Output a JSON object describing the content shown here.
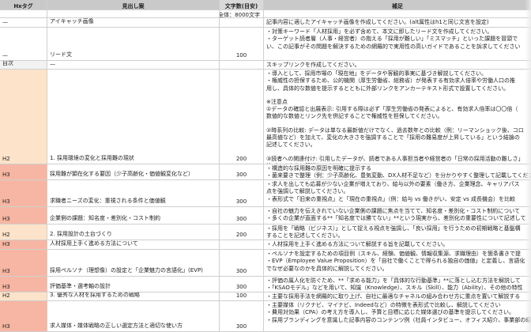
{
  "header": {
    "col1": "Hxタグ",
    "col2": "見出し案",
    "col3": "文字数(目安)",
    "col4": "補足"
  },
  "total_row": {
    "label": "全体：8000文字"
  },
  "rows": [
    {
      "tag": "—",
      "heading": "アイキャッチ画像",
      "chars": "",
      "notes": [
        "記事内容に適したアイキャッチ画像を作成してください。(alt属性はh1と同じ文言を設定)"
      ]
    },
    {
      "tag": "—",
      "heading": "リード文",
      "chars": "100",
      "notes": [
        "・対策キーワード「人材採用」を必ず含めて、本文に即したリード文を作成してください。",
        "・ターゲット読者層（人事・経営者）の抱える「採用が難しい」「ミスマッチ」といった課題を冒頭で",
        "い、この記事がその問題を解決するための網羅的で実用性の高いガイドであることを訴求してください"
      ]
    },
    {
      "tag": "目次",
      "heading": "—",
      "chars": "",
      "notes": [
        "スキップリンクを作成してください。"
      ]
    },
    {
      "tag": "H2",
      "heading": "1.  採用環境の変化と採用難の現状",
      "chars": "200",
      "notes": [
        "・導入として、採用市場の「現在地」をデータや客観的事実に基づき解説してください。",
        "・権威性の担保するため、公的機関（厚生労働省、総務省）が発表する有効求人倍率や労働人口の推",
        "用し、具体的な数値を提示するとともに外部リンクをアンカーテキスト形式で設置してください。",
        "",
        "※注意点",
        "①データの確認と出展表示: 引用する際は必ず「厚生労働省の発表によると、有効求人倍率は〇〇倍（",
        "数値的な数値とリンク先を併記することで権威性を担保してください。",
        "",
        "②時系列の比較: データは単なる最新値だけでなく、過去数年との比較（例：リーマンショック後、コロ",
        "最高値など）を加えて、変化の大きさを強調することで「採用の難易度が上昇している」という結論の",
        "記述してください。",
        "",
        "③読者への関連付け: 引用したデータが、読者である人事担当者や経営者の「日常の採用活動の難しさ」",
        "結びつくように解説してください。"
      ]
    },
    {
      "tag": "H3",
      "heading": "採用難が顕在化する要因（少子高齢化・価値観変化など）",
      "chars": "300",
      "notes": [
        "・構造的な採用難の原因を明確に提示する",
        "・菌来要きで整理（例：少子高齢化、豊気変動、DX人材不足など）を分かりやすく整理して記載してください"
      ]
    },
    {
      "tag": "H3",
      "heading": "求職者ニーズの変化：重視される条件と価値観",
      "chars": "300",
      "notes": [
        "・求人を出しても応募が少ない企業が増えており、給与以外の要素（働き方、企業理念、キャリアパス",
        "点を強調して解説してください。",
        "・表形式で「旧来の重視点」と「現在の重視点」（例：給与 vs 働きがい、安定 vs 成長機会）を比較"
      ]
    },
    {
      "tag": "H3",
      "heading": "企業側の課題：知名度・差別化・コスト制約",
      "chars": "300",
      "notes": [
        "・自社の魅力を伝えきれていない企業側の課題に焦点を当てて、知名度・差別化・コスト制約について",
        "・多くの企業が直面する**「知名度では勝てない」**という現実から、差別化の重要性について記述して"
      ]
    },
    {
      "tag": "H2",
      "heading": "2.  採用設計の土台づくり",
      "chars": "200",
      "notes": [
        "・採用を「戦略（ビジネス）」として捉える視点を強調し、「良い採用」を行うための初期戦略と基盤構",
        "することを記述してください。"
      ]
    },
    {
      "tag": "H3",
      "heading": "人材採用上手く進める方法について",
      "chars": "",
      "notes": [
        "・人材採用を上手く進める方法について解説する旨を記載してください。"
      ]
    },
    {
      "tag": "H3",
      "heading": "採用ペルソナ（理想像）の設定と「企業魅力の言語化」(EVP)",
      "chars": "300",
      "notes": [
        "・ペルソナを設定するための項目例（スキル、経験、価値観、情報収集源、求職理由）を箇条書きで提",
        "・EVP（Employee Value Proposition）を「自社で働くことで得られる独自の価値」と定義し、言語化",
        "でなぜ必要なのかを具体的に解説してください。"
      ]
    },
    {
      "tag": "H3",
      "heading": "評価基準・選考軸の設計",
      "chars": "300",
      "notes": [
        "・評価の属人化を防ぐため、**「求める能力」を「具体的な行動基準」**に落とし込む方法を解説して",
        "・「KSAOモデル」などを用いて、知識（Knowledge）、スキル（Skill）、能力（Ability）、その他の特性"
      ]
    },
    {
      "tag": "H2",
      "heading": "3.  優秀な人材を採用するための戦略",
      "chars": "100",
      "notes": [
        "・主要な採用手法を網羅的に取り上げ、自社に最適なチャネルの組み合わせ方に重点を置いて解説する"
      ]
    },
    {
      "tag": "H3",
      "heading": "求人媒体・媒体戦略の正しい選定方法と適切な使い方",
      "chars": "300",
      "notes": [
        "・主要媒体（リクナビ、マイナビ、Indeedなど）の特徴を表形式で比較し、解説してください",
        "・費用対効果（CPA）の考え方を導入し、予算と目標に応じた媒体選びの基準を提示してください。",
        "・採用ブランディングを意識した記事内容のコンテンツ例（社員インタビュー、オフィス紹介、事業部の紹介"
      ]
    }
  ]
}
